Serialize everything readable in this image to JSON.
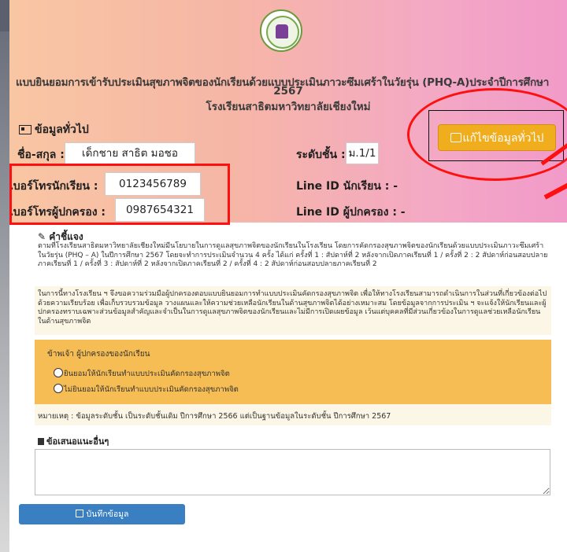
{
  "school_logo_name": "school-logo-icon",
  "header": {
    "title_line1": "แบบยินยอมการเข้ารับประเมินสุขภาพจิตของนักเรียนด้วยแบบประเมินภาวะซึมเศร้าในวัยรุ่น (PHQ-A)ประจำปีการศึกษา",
    "title_line2": "2567",
    "title_line3": "โรงเรียนสาธิตมหาวิทยาลัยเชียงใหม่"
  },
  "general_info": {
    "section_title": "ข้อมูลทั่วไป",
    "name_label": "ชื่อ-สกุล :",
    "name_value": "เด็กชาย สาธิต มอชอ",
    "grade_label": "ระดับชั้น :",
    "grade_value": "ม.1/1",
    "student_phone_label": "เบอร์โทรนักเรียน :",
    "student_phone_value": "0123456789",
    "parent_phone_label": "เบอร์โทรผู้ปกครอง :",
    "parent_phone_value": "0987654321",
    "student_line_label": "Line ID นักเรียน : -",
    "parent_line_label": "Line ID ผู้ปกครอง : -",
    "edit_button_label": "แก้ไขข้อมูลทั่วไป"
  },
  "instructions": {
    "title": "คำชี้แจง",
    "paragraph1": "ตามที่โรงเรียนสาธิตมหาวิทยาลัยเชียงใหม่มีนโยบายในการดูแลสุขภาพจิตของนักเรียนในโรงเรียน โดยการคัดกรองสุขภาพจิตของนักเรียนด้วยแบบประเมินภาวะซึมเศร้าในวัยรุ่น (PHQ – A) ในปีการศึกษา 2567 โดยจะทำการประเมินจำนวน 4 ครั้ง ได้แก่ ครั้งที่ 1 : สัปดาห์ที่ 2 หลังจากเปิดภาคเรียนที่ 1 / ครั้งที่ 2 : 2 สัปดาห์ก่อนสอบปลายภาคเรียนที่ 1 / ครั้งที่ 3 : สัปดาห์ที่ 2 หลังจากเปิดภาคเรียนที่ 2 / ครั้งที่ 4 : 2 สัปดาห์ก่อนสอบปลายภาคเรียนที่ 2",
    "paragraph2": "ในการนี้ทางโรงเรียน ฯ จึงขอความร่วมมือผู้ปกครองตอบแบบยินยอมการทำแบบประเมินคัดกรองสุขภาพจิต เพื่อให้ทางโรงเรียนสามารถดำเนินการในส่วนที่เกี่ยวข้องต่อไป ด้วยความเรียบร้อย เพื่อเก็บรวบรวมข้อมูล วางแผนและให้ความช่วยเหลือนักเรียนในด้านสุขภาพจิตได้อย่างเหมาะสม โดยข้อมูลจากการประเมิน ฯ จะแจ้งให้นักเรียนและผู้ปกครองทราบเฉพาะส่วนข้อมูลสำคัญและจำเป็นในการดูแลสุขภาพจิตของนักเรียนและไม่มีการเปิดเผยข้อมูล เว้นแต่บุคคลที่มีส่วนเกี่ยวข้องในการดูแลช่วยเหลือนักเรียน ในด้านสุขภาพจิต"
  },
  "consent": {
    "title": "ข้าพเจ้า ผู้ปกครองของนักเรียน",
    "option_agree": "ยินยอมให้นักเรียนทำแบบประเมินคัดกรองสุขภาพจิต",
    "option_disagree": "ไม่ยินยอมให้นักเรียนทำแบบประเมินคัดกรองสุขภาพจิต"
  },
  "note": "หมายเหตุ : ข้อมูลระดับชั้น เป็นระดับชั้นเดิม ปีการศึกษา 2566 แต่เป็นฐานข้อมูลในระดับชั้น ปีการศึกษา 2567",
  "suggestions": {
    "title": "ข้อเสนอแนะอื่นๆ",
    "placeholder": ""
  },
  "save_button_label": "บันทึกข้อมูล",
  "colors": {
    "edit_button": "#f0ad1e",
    "save_button": "#3a7fc1",
    "highlight_red": "#ff1010",
    "consent_panel": "#f5bd53"
  }
}
